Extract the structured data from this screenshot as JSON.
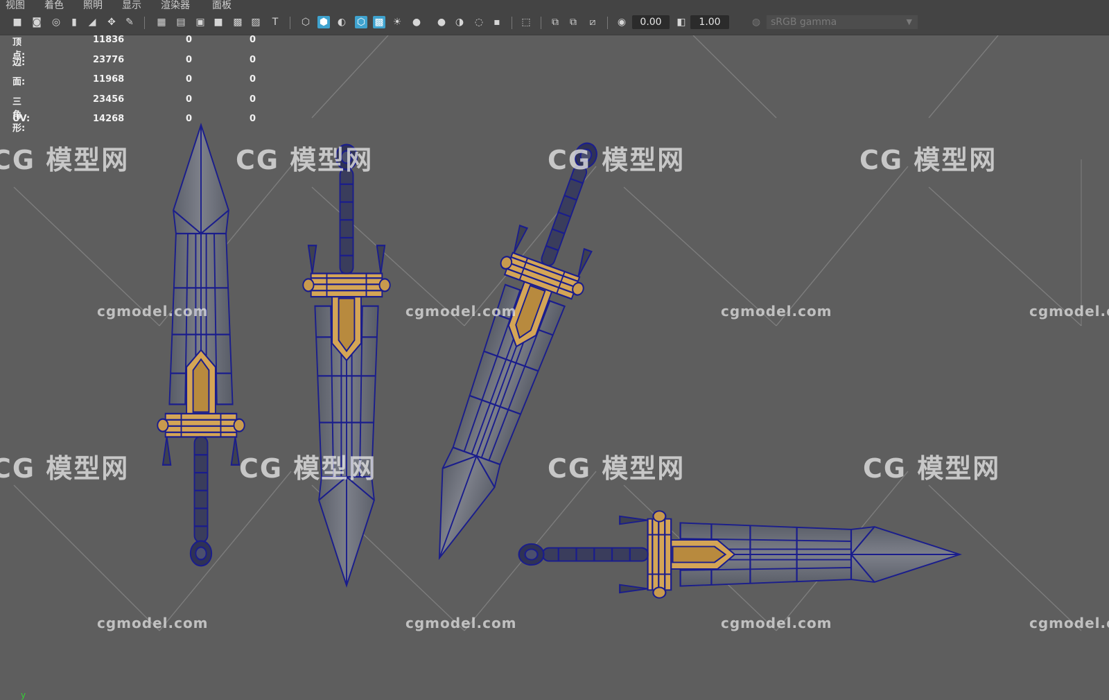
{
  "menubar": {
    "items": [
      "视图",
      "着色",
      "照明",
      "显示",
      "渲染器",
      "面板"
    ]
  },
  "toolbar": {
    "icons": [
      "camera-icon",
      "camera-lock-icon",
      "camera-attr-icon",
      "bookmark-icon",
      "image-plane-icon",
      "2d-pan-icon",
      "grease-pencil-icon",
      "grid-icon",
      "film-gate-icon",
      "resolution-gate-icon",
      "gate-mask-icon",
      "field-chart-icon",
      "safe-action-icon",
      "safe-title-icon",
      "wireframe-icon",
      "smooth-shade-icon",
      "default-material-icon",
      "wireframe-on-shaded-icon",
      "xray-icon",
      "use-lights-icon",
      "shadows-icon",
      "screen-space-ao-icon",
      "motion-blur-icon",
      "multisample-aa-icon",
      "depth-of-field-icon",
      "isolate-select-icon",
      "xray-joints-icon",
      "xray-active-icon",
      "backface-culling-icon",
      "exposure-icon",
      "gamma-icon",
      "color-management-icon"
    ],
    "exposure_value": "0.00",
    "gamma_value": "1.00",
    "color_space": "sRGB gamma",
    "accent_color": "#3fa3cf"
  },
  "hud": {
    "rows": [
      {
        "label": "顶点:",
        "v1": "11836",
        "v2": "0",
        "v3": "0"
      },
      {
        "label": "边:",
        "v1": "23776",
        "v2": "0",
        "v3": "0"
      },
      {
        "label": "面:",
        "v1": "11968",
        "v2": "0",
        "v3": "0"
      },
      {
        "label": "三角形:",
        "v1": "23456",
        "v2": "0",
        "v3": "0"
      },
      {
        "label": "UV:",
        "v1": "14268",
        "v2": "0",
        "v3": "0"
      }
    ]
  },
  "watermark": {
    "site": "cgmodel.com",
    "logo": "CG 模型网"
  },
  "viewport": {
    "axis_label": "y",
    "wire_color": "#1a1d8c",
    "guard_color": "#d4a556"
  }
}
